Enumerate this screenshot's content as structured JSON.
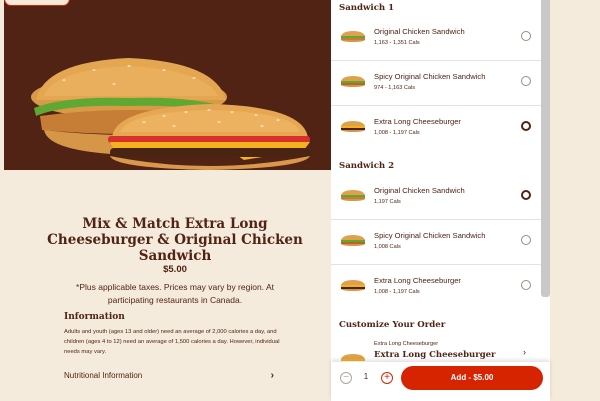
{
  "product": {
    "title": "Mix & Match Extra Long Cheeseburger & Original Chicken Sandwich",
    "price": "$5.00",
    "tax_note": "*Plus applicable taxes. Prices may vary by region. At participating restaurants in Canada.",
    "info_heading": "Information",
    "info_text": "Adults and youth (ages 13 and older) need an average of 2,000 calories a day, and children (ages 4 to 12) need an average of 1,500 calories a day. However, individual needs may vary.",
    "nutrition_label": "Nutritional Information"
  },
  "sandwich1": {
    "heading": "Sandwich 1",
    "items": [
      {
        "name": "Original Chicken Sandwich",
        "cals": "1,163 - 1,351 Cals",
        "selected": false
      },
      {
        "name": "Spicy Original Chicken Sandwich",
        "cals": "974 - 1,163 Cals",
        "selected": false
      },
      {
        "name": "Extra Long Cheeseburger",
        "cals": "1,008 - 1,197 Cals",
        "selected": true
      }
    ]
  },
  "sandwich2": {
    "heading": "Sandwich 2",
    "items": [
      {
        "name": "Original Chicken Sandwich",
        "cals": "1,197 Cals",
        "selected": true
      },
      {
        "name": "Spicy Original Chicken Sandwich",
        "cals": "1,008 Cals",
        "selected": false
      },
      {
        "name": "Extra Long Cheeseburger",
        "cals": "1,008 - 1,197 Cals",
        "selected": false
      }
    ]
  },
  "customize": {
    "heading": "Customize Your Order",
    "item_sub": "Extra Long Cheeseburger",
    "item_main": "Extra Long Cheeseburger"
  },
  "footer": {
    "minus": "−",
    "quantity": "1",
    "plus": "+",
    "add_label": "Add - $5.00"
  },
  "colors": {
    "brand_brown": "#502314",
    "brand_red": "#d62300",
    "background": "#f5ebdc"
  }
}
